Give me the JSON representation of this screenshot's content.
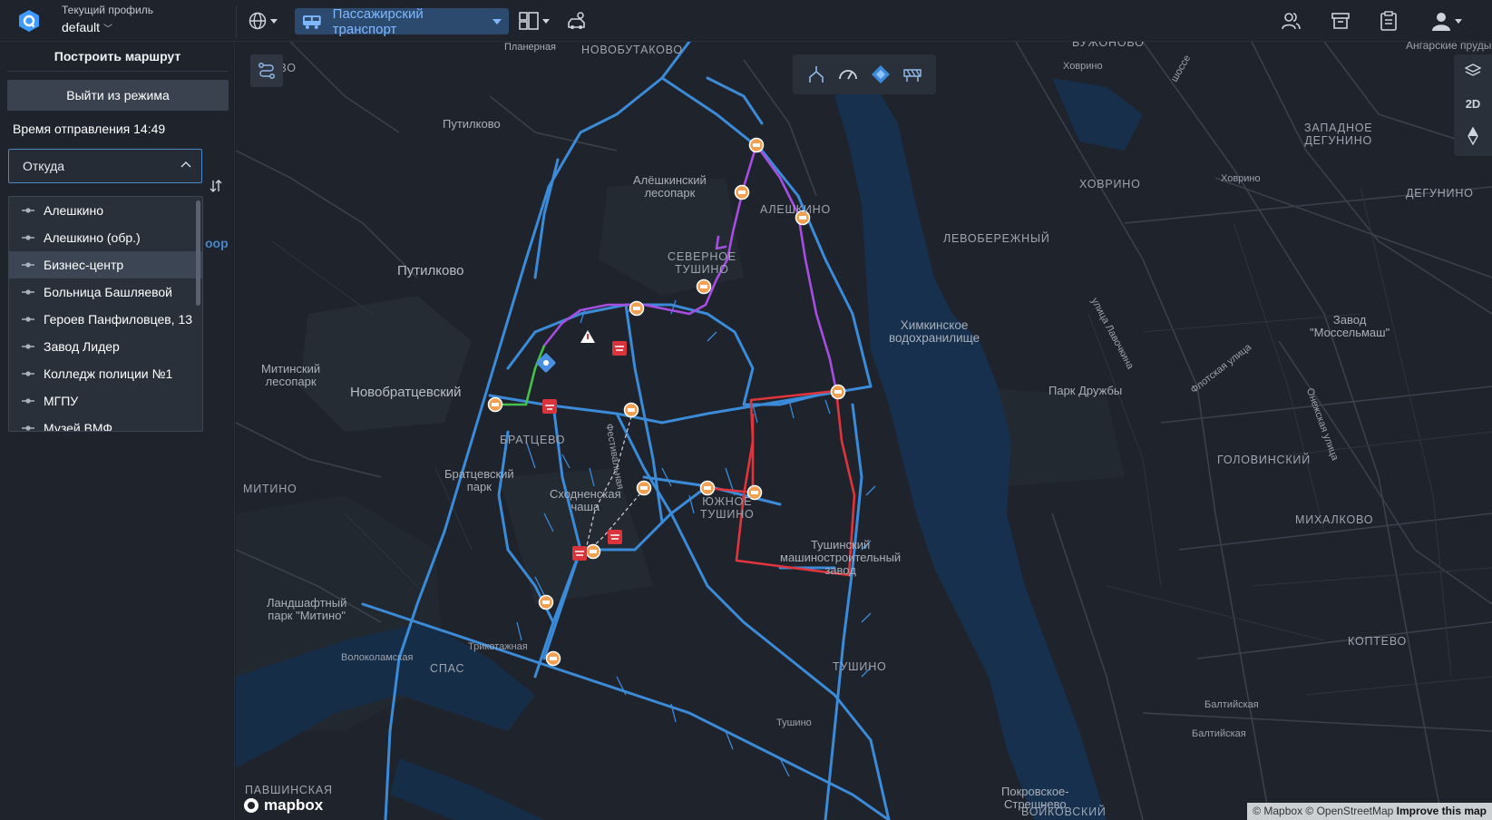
{
  "profile": {
    "label": "Текущий профиль",
    "value": "default"
  },
  "toolbar": {
    "transport_label": "Пассажирский транспорт"
  },
  "sidebar": {
    "title": "Построить маршрут",
    "exit_button": "Выйти из режима",
    "departure_time": "Время отправления 14:49",
    "from_placeholder": "Откуда",
    "hidden_fragment": "оор",
    "stops": [
      {
        "label": "Алешкино"
      },
      {
        "label": "Алешкино (обр.)"
      },
      {
        "label": "Бизнес-центр"
      },
      {
        "label": "Больница Башляевой"
      },
      {
        "label": "Героев Панфиловцев, 13"
      },
      {
        "label": "Завод Лидер"
      },
      {
        "label": "Колледж полиции №1"
      },
      {
        "label": "МГПУ"
      },
      {
        "label": "Музей ВМФ"
      }
    ],
    "active_stop_index": 2
  },
  "map": {
    "labels": {
      "novobutakovo": "НОВОБУТАКОВО",
      "putilkovo_tl": "Путилково",
      "mkovo": "ЛКОВО",
      "aleshkinsky_park": "Алёшкинский\nлесопарк",
      "aleshkino": "АЛЕШКИНО",
      "severnoe_tushino": "СЕВЕРНОЕ\nТУШИНО",
      "putilkovo_big": "Путилково",
      "mitinsky_park": "Митинский\nлесопарк",
      "novobratsevsky": "Новобратцевский",
      "bratsevo": "БРАТЦЕВО",
      "bratsevsky_park": "Братцевский\nпарк",
      "skhodnenskaya": "Сходненская\nчаша",
      "mitino": "МИТИНО",
      "yuzhnoe_tushino": "ЮЖНОЕ\nТУШИНО",
      "tmz": "Тушинский\nмашиностроительный\nзавод",
      "landscape_park": "Ландшафтный\nпарк \"Митино\"",
      "volokolamskaya": "Волоколамская",
      "trikotazhnaya": "Трикотажная",
      "spas": "СПАС",
      "tushino_caps": "ТУШИНО",
      "tushino": "Тушино",
      "pavshinskaya": "ПАВШИНСКАЯ",
      "pokrovskoe": "Покровское-\nСтрешнево",
      "voykovsky": "ВОЙКОВСКИЙ",
      "khimki_reservoir": "Химкинское\nводохранилище",
      "levoberezhny": "ЛЕВОБЕРЕЖНЫЙ",
      "khovrino_caps": "ХОВРИНО",
      "khovrino_small1": "Ховрино",
      "khovrino_small2": "Ховрино",
      "zapadnoe_degunino": "ЗАПАДНОЕ\nДЕГУНИНО",
      "degunino": "ДЕГУНИНО",
      "angarskie": "Ангарские пруды",
      "buzhonovo": "БУЖОНОВО",
      "mosselmash": "Завод\n\"Моссельмаш\"",
      "park_druzhby": "Парк Дружбы",
      "golovinsky": "ГОЛОВИНСКИЙ",
      "mikhalkovo": "МИХАЛКОВО",
      "koptevo": "КОПТЕВО",
      "baltiyskaya1": "Балтийская",
      "baltiyskaya2": "Балтийская",
      "lavochkina": "улица Лавочкина",
      "flotskaya": "Флотская улица",
      "onezhskaya": "Онежская улица",
      "shosse": "шоссе",
      "vertical_street": "Планерная",
      "freeway_label": "Фестивальная"
    },
    "controls": {
      "mode_2d": "2D"
    },
    "attribution": "© Mapbox © OpenStreetMap",
    "improve": "Improve this map",
    "brand": "mapbox",
    "colors": {
      "purple_route": "#a64ee0",
      "red_route": "#e0353d",
      "green_route": "#45c14a",
      "blue_roads": "#3b8bd8",
      "stop": "#f0a050"
    }
  }
}
